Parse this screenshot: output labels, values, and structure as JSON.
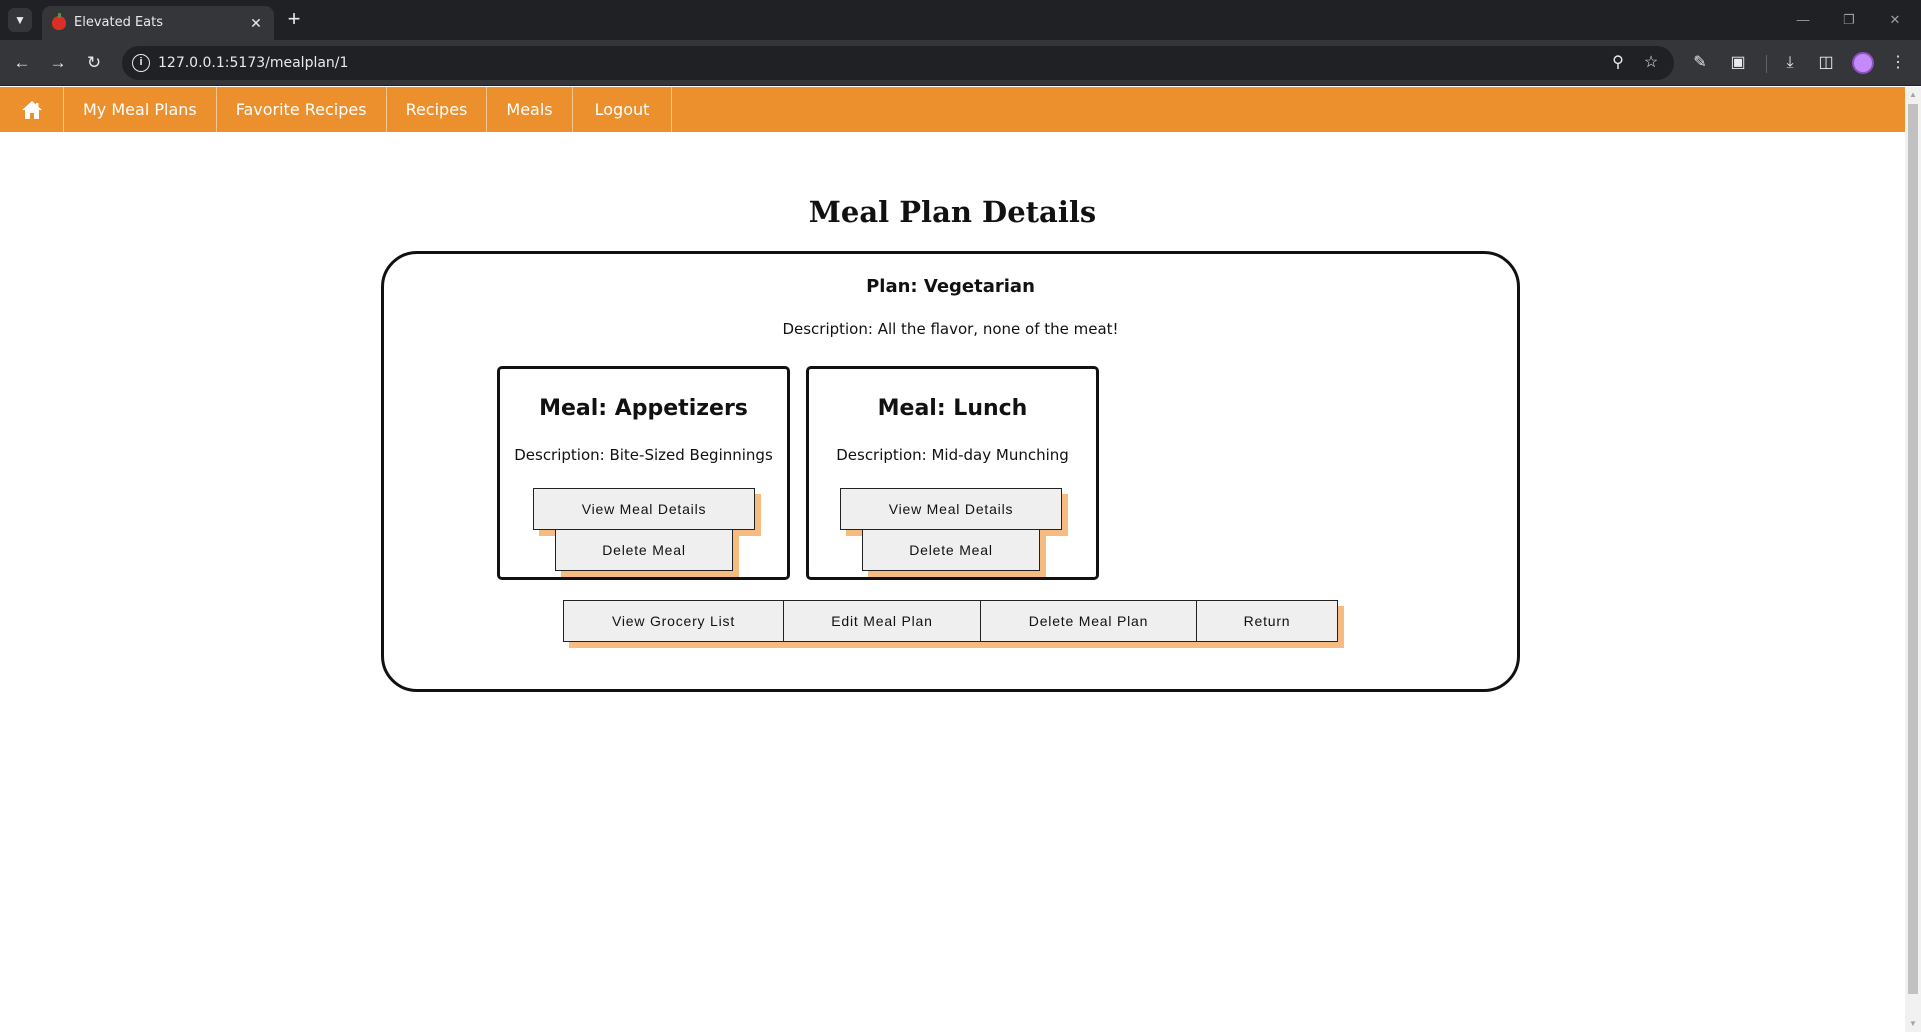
{
  "browser": {
    "tab_title": "Elevated Eats",
    "url": "127.0.0.1:5173/mealplan/1",
    "tab_close_glyph": "✕",
    "new_tab_glyph": "+"
  },
  "nav": {
    "home_icon": "home-icon",
    "links": [
      "My Meal Plans",
      "Favorite Recipes",
      "Recipes",
      "Meals",
      "Logout"
    ],
    "background": "#ec8f2d"
  },
  "page": {
    "title": "Meal Plan Details"
  },
  "plan": {
    "name": "Plan: Vegetarian",
    "description": "Description: All the flavor, none of the meat!",
    "meals": [
      {
        "title": "Meal: Appetizers",
        "description": "Description: Bite-Sized Beginnings",
        "view_label": "View Meal Details",
        "delete_label": "Delete Meal"
      },
      {
        "title": "Meal: Lunch",
        "description": "Description: Mid-day Munching",
        "view_label": "View Meal Details",
        "delete_label": "Delete Meal"
      }
    ],
    "actions": {
      "grocery_label": "View Grocery List",
      "edit_label": "Edit Meal Plan",
      "delete_label": "Delete Meal Plan",
      "return_label": "Return"
    }
  },
  "colors": {
    "accent": "#ec8f2d",
    "button_shadow": "#f6bb80"
  }
}
